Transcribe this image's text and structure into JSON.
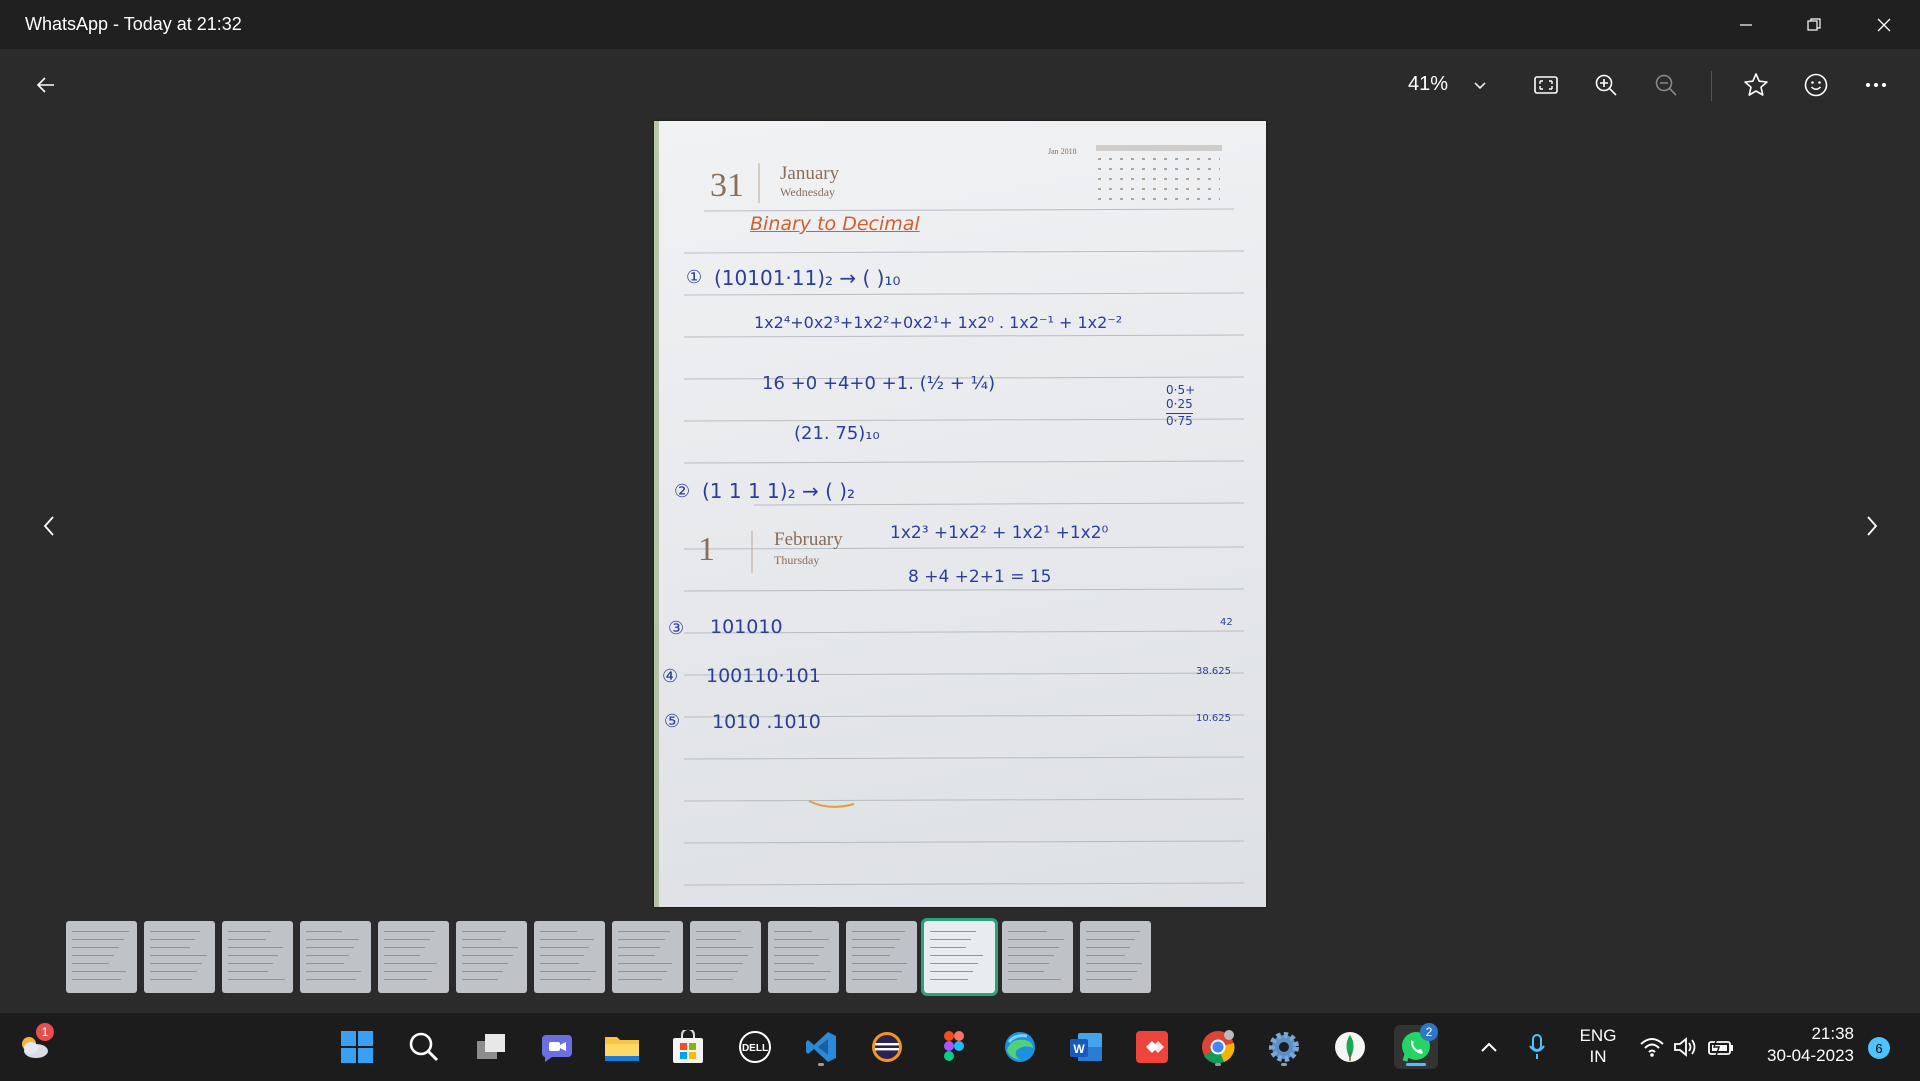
{
  "window": {
    "title": "WhatsApp - Today at 21:32",
    "controls": [
      "minimize",
      "restore",
      "close"
    ]
  },
  "toolbar": {
    "back_icon": "arrow-left-icon",
    "zoom_value": "41%",
    "zoom_dropdown_icon": "chevron-down-icon",
    "buttons": [
      "fit-to-window-icon",
      "zoom-in-icon",
      "zoom-out-icon",
      "favorite-star-icon",
      "react-emoji-icon",
      "more-icon"
    ]
  },
  "note": {
    "date_day": "31",
    "date_month": "January",
    "date_weekday": "Wednesday",
    "mini_calendar_title": "Jan 2018",
    "date2_day": "1",
    "date2_month": "February",
    "date2_weekday": "Thursday",
    "heading": "Binary to Decimal",
    "q1_label": "①",
    "q1": "(10101·11)₂ → ( )₁₀",
    "q1_step1": "1x2⁴+0x2³+1x2²+0x2¹+ 1x2⁰ . 1x2⁻¹ + 1x2⁻²",
    "q1_step2": "16 +0 +4+0 +1. (½ + ¼)",
    "q1_step3": "(21. 75)₁₀",
    "q1_side_a": "0·5+",
    "q1_side_b": "0·25",
    "q1_side_c": "0·75",
    "q2_label": "②",
    "q2": "(1 1 1 1)₂ → ( )₂",
    "q2_step1": "1x2³ +1x2² + 1x2¹ +1x2⁰",
    "q2_step2": "8 +4 +2+1  = 15",
    "q3_label": "③",
    "q3": "101010",
    "q3_answer": "42",
    "q4_label": "④",
    "q4": "100110·101",
    "q4_answer": "38.625",
    "q5_label": "⑤",
    "q5": "1010 .1010",
    "q5_answer": "10.625"
  },
  "filmstrip": {
    "count": 14,
    "selected_index": 11
  },
  "taskbar": {
    "weather_badge": "1",
    "apps": [
      {
        "name": "start-icon"
      },
      {
        "name": "search-icon"
      },
      {
        "name": "task-view-icon"
      },
      {
        "name": "chat-icon"
      },
      {
        "name": "file-explorer-icon"
      },
      {
        "name": "microsoft-store-icon"
      },
      {
        "name": "dell-icon"
      },
      {
        "name": "vscode-icon"
      },
      {
        "name": "eclipse-icon"
      },
      {
        "name": "figma-icon"
      },
      {
        "name": "edge-browser-icon"
      },
      {
        "name": "word-icon"
      },
      {
        "name": "anydesk-icon"
      },
      {
        "name": "chrome-icon"
      },
      {
        "name": "settings-icon"
      },
      {
        "name": "mongodb-compass-icon"
      },
      {
        "name": "whatsapp-icon"
      }
    ],
    "whatsapp_badge": "2",
    "lang_line1": "ENG",
    "lang_line2": "IN",
    "time": "21:38",
    "date": "30-04-2023",
    "notification_count": "6"
  },
  "colors": {
    "accent": "#4cc2ff",
    "selected_thumb": "#2aa37a",
    "ink": "#2c3f98",
    "heading_ink": "#d2602d"
  }
}
